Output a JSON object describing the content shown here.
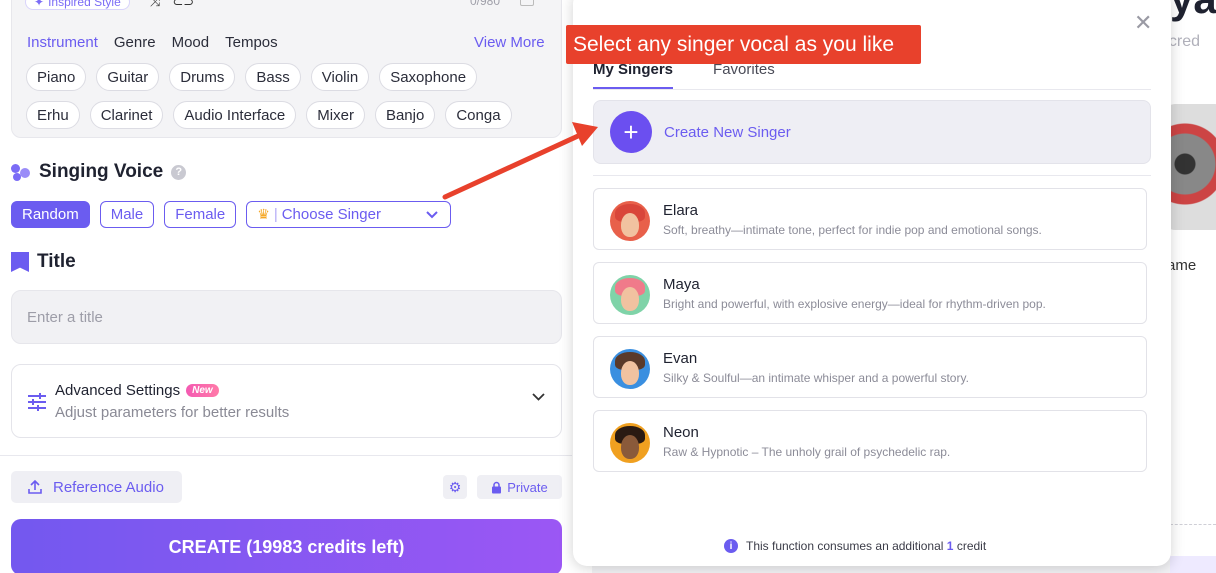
{
  "top_card": {
    "inspired_label": "Inspired Style",
    "counter": "0/980"
  },
  "instrument_tabs": [
    "Instrument",
    "Genre",
    "Mood",
    "Tempos"
  ],
  "view_more": "View More",
  "chips_row1": [
    "Piano",
    "Guitar",
    "Drums",
    "Bass",
    "Violin",
    "Saxophone"
  ],
  "chips_row2": [
    "Erhu",
    "Clarinet",
    "Audio Interface",
    "Mixer",
    "Banjo",
    "Conga"
  ],
  "singing_voice": {
    "title": "Singing Voice",
    "help": "?",
    "buttons": [
      "Random",
      "Male",
      "Female"
    ],
    "choose_singer": "Choose Singer"
  },
  "title_section": {
    "label": "Title",
    "placeholder": "Enter a title"
  },
  "advanced": {
    "title": "Advanced Settings",
    "badge": "New",
    "subtitle": "Adjust parameters for better results"
  },
  "bottom": {
    "reference_audio": "Reference Audio",
    "private": "Private",
    "create": "CREATE (19983 credits left)"
  },
  "background": {
    "big_text": "ya",
    "credits_text": "t cred",
    "name_text": "ame"
  },
  "modal": {
    "tabs": [
      "My Singers",
      "Favorites"
    ],
    "create_new": "Create New Singer",
    "singers": [
      {
        "name": "Elara",
        "desc": "Soft, breathy—intimate tone, perfect for indie pop and emotional songs.",
        "bg": "#e8604a",
        "hair": "#d9463a"
      },
      {
        "name": "Maya",
        "desc": "Bright and powerful, with explosive energy—ideal for rhythm-driven pop.",
        "bg": "#7fd3a8",
        "hair": "#f07a8a"
      },
      {
        "name": "Evan",
        "desc": "Silky & Soulful—an intimate whisper and a powerful story.",
        "bg": "#3a8fe0",
        "hair": "#5a3a2a"
      },
      {
        "name": "Neon",
        "desc": "Raw & Hypnotic – The unholy grail of psychedelic rap.",
        "bg": "#f0a020",
        "hair": "#2a1a12"
      }
    ],
    "footer_prefix": "This function consumes an additional",
    "footer_number": "1",
    "footer_suffix": "credit"
  },
  "annotation": {
    "callout": "Select any singer vocal as you like"
  }
}
